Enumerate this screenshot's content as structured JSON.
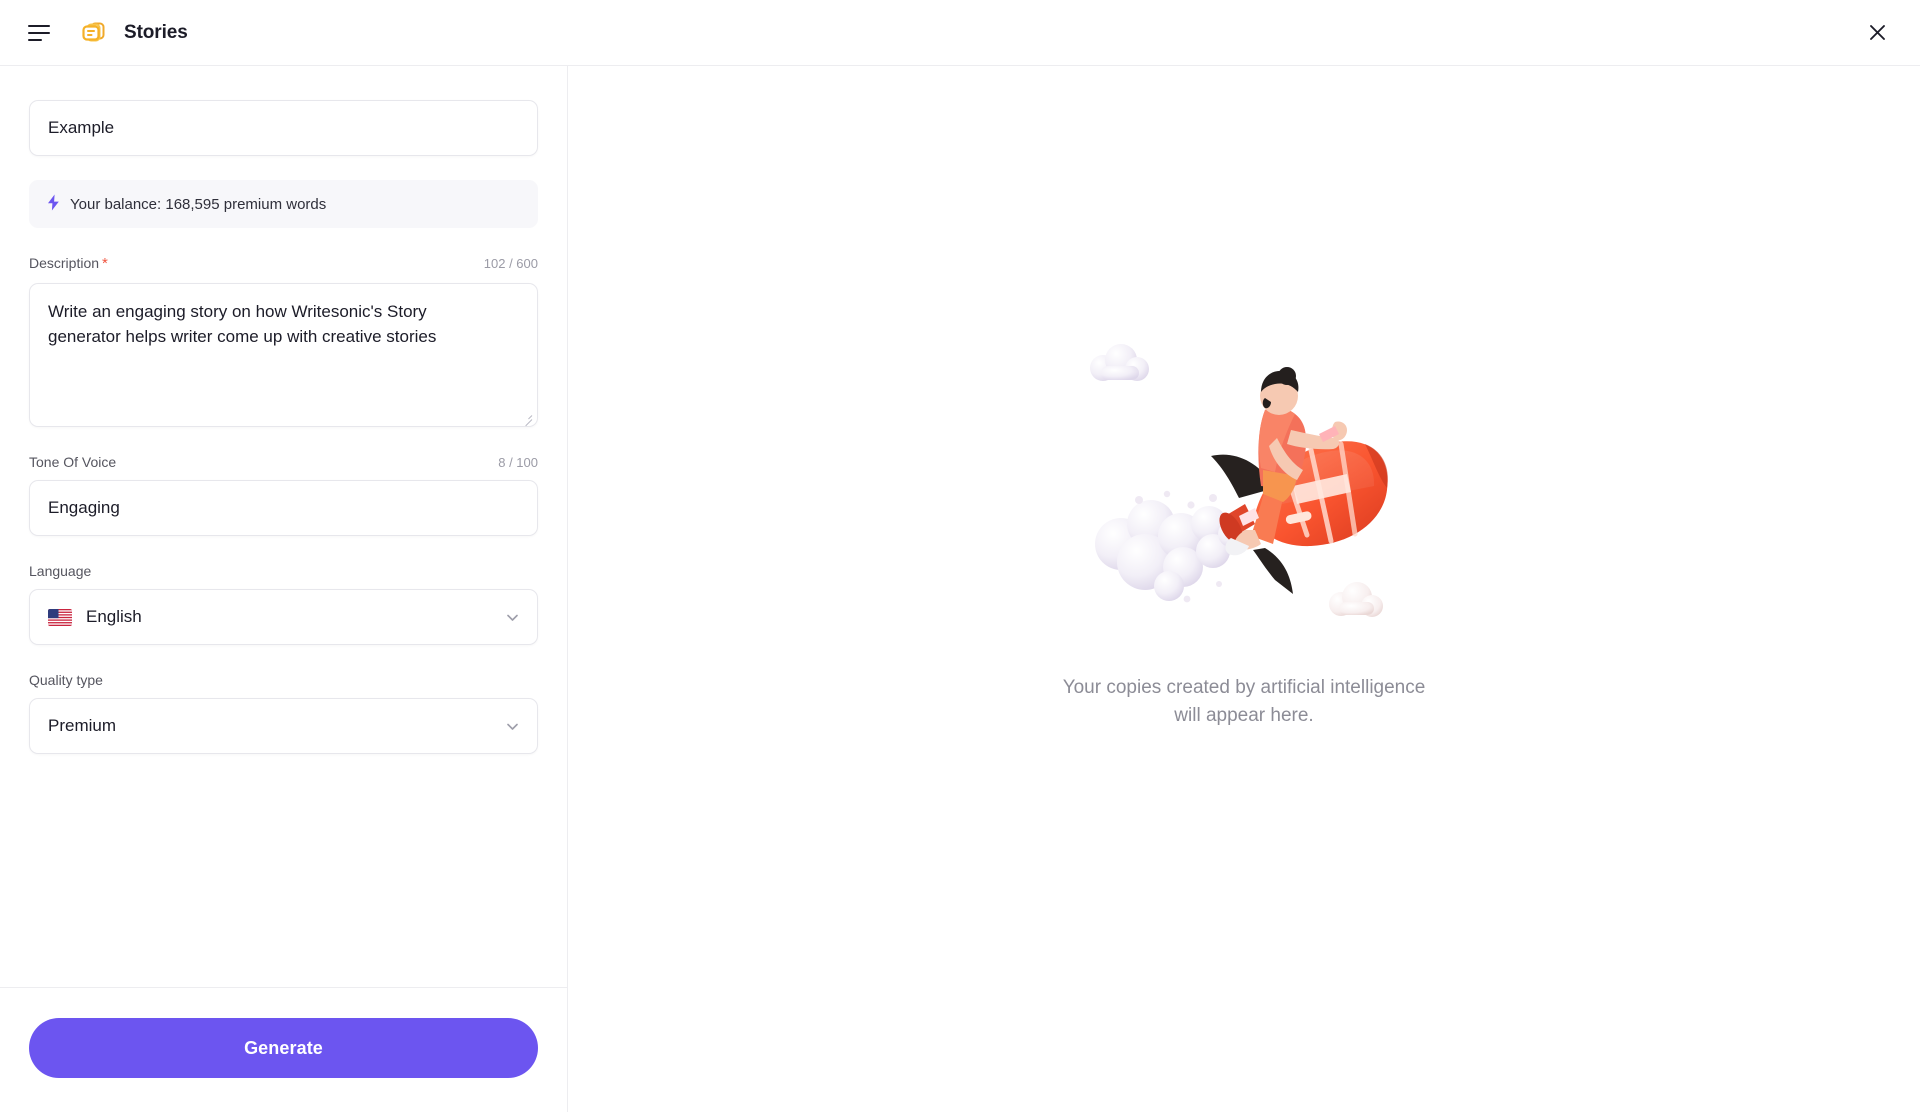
{
  "header": {
    "menu_icon": "hamburger-menu-icon",
    "app_icon": "stories-app-icon",
    "title": "Stories",
    "close_icon": "close-icon"
  },
  "form": {
    "project_name": {
      "value": "Example"
    },
    "balance": {
      "icon": "lightning-bolt-icon",
      "text": "Your balance: 168,595 premium words"
    },
    "description": {
      "label": "Description",
      "required_marker": "*",
      "counter": "102 / 600",
      "value": "Write an engaging story on how Writesonic's Story generator helps writer come up with creative stories"
    },
    "tone_of_voice": {
      "label": "Tone Of Voice",
      "counter": "8 / 100",
      "value": "Engaging"
    },
    "language": {
      "label": "Language",
      "flag": "us-flag-icon",
      "value": "English",
      "chevron": "chevron-down-icon"
    },
    "quality_type": {
      "label": "Quality type",
      "value": "Premium",
      "chevron": "chevron-down-icon"
    },
    "generate_button": "Generate"
  },
  "results": {
    "illustration": "person-riding-rocket-illustration",
    "empty_state_line1": "Your copies created by artificial intelligence",
    "empty_state_line2": "will appear here."
  },
  "colors": {
    "accent": "#6c55f0",
    "app_icon": "#f5b128",
    "required": "#f0543f",
    "muted_text": "#8c8c96",
    "border": "#ededf0"
  }
}
